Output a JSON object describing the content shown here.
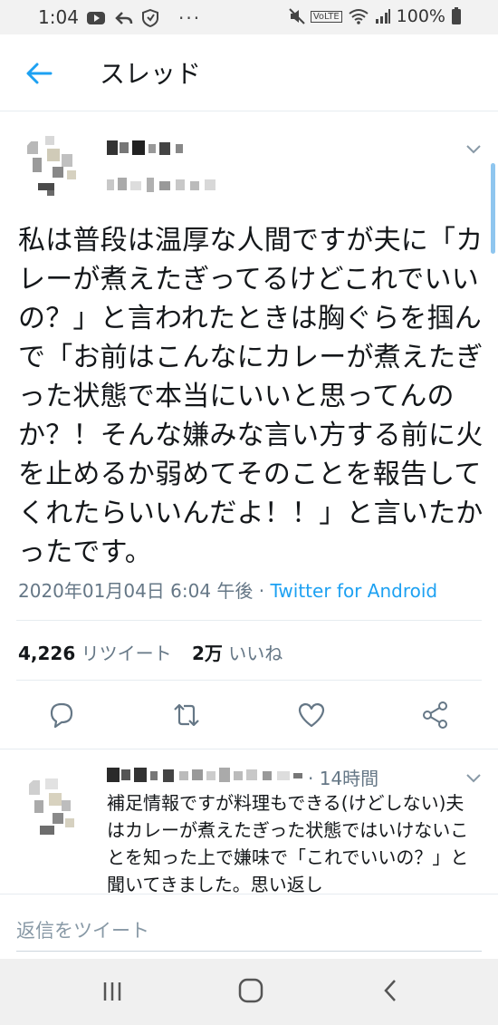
{
  "status_bar": {
    "time": "1:04",
    "battery": "100%",
    "icons_left": [
      "youtube-icon",
      "reply-arrow-icon",
      "shield-icon",
      "more-dots-icon"
    ],
    "icons_right": [
      "mute-icon",
      "volte-icon",
      "wifi-icon",
      "signal-icon",
      "battery-icon"
    ],
    "volte_label": "VoLTE"
  },
  "header": {
    "title": "スレッド",
    "accent_color": "#1da1f2"
  },
  "tweet": {
    "text": "私は普段は温厚な人間ですが夫に「カレーが煮えたぎってるけどこれでいいの？」と言われたときは胸ぐらを掴んで「お前はこんなにカレーが煮えたぎった状態で本当にいいと思ってんのか？！そんな嫌みな言い方する前に火を止めるか弱めてそのことを報告してくれたらいいんだよ！！」と言いたかったです。",
    "timestamp": "2020年01月04日 6:04 午後",
    "separator": " · ",
    "source": "Twitter for Android",
    "retweets_count": "4,226",
    "retweets_label": "リツイート",
    "likes_count": "2万",
    "likes_label": "いいね"
  },
  "actions": [
    "reply-icon",
    "retweet-icon",
    "like-icon",
    "share-icon"
  ],
  "reply": {
    "time": "· 14時間",
    "text": "補足情報ですが料理もできる(けどしない)夫はカレーが煮えたぎった状態ではいけないことを知った上で嫌味で「これでいいの？」と聞いてきました。思い返し"
  },
  "compose": {
    "placeholder": "返信をツイート"
  },
  "navigation": [
    "recent-apps-icon",
    "home-icon",
    "back-icon"
  ]
}
